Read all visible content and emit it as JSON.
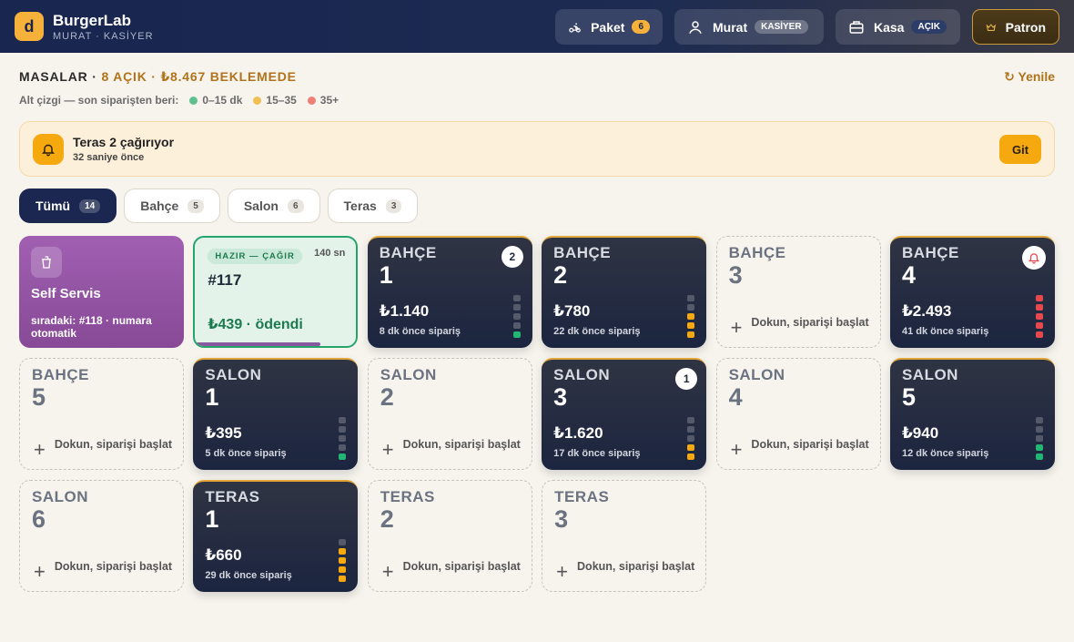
{
  "app": {
    "logo_letter": "d",
    "name": "BurgerLab",
    "user_line": "MURAT · KASİYER"
  },
  "header": {
    "package": {
      "label": "Paket",
      "count": "6",
      "icon": "scooter-icon"
    },
    "user": {
      "label": "Murat",
      "role": "KASİYER",
      "icon": "user-icon"
    },
    "register": {
      "label": "Kasa",
      "status": "AÇIK",
      "icon": "register-icon"
    },
    "boss": {
      "label": "Patron",
      "icon": "crown-icon"
    }
  },
  "summary": {
    "prefix": "MASALAR · ",
    "open": "8 AÇIK · ₺8.467 BEKLEMEDE",
    "refresh": "↻ Yenile"
  },
  "legend": {
    "label": "Alt çizgi — son siparişten beri:",
    "items": [
      {
        "text": "0–15 dk",
        "color": "#5fbf8f"
      },
      {
        "text": "15–35",
        "color": "#f2bf55"
      },
      {
        "text": "35+",
        "color": "#ee7f74"
      }
    ]
  },
  "alert": {
    "title": "Teras 2 çağırıyor",
    "subtitle": "32 saniye önce",
    "button": "Git"
  },
  "filters": [
    {
      "label": "Tümü",
      "count": "14"
    },
    {
      "label": "Bahçe",
      "count": "5"
    },
    {
      "label": "Salon",
      "count": "6"
    },
    {
      "label": "Teras",
      "count": "3"
    }
  ],
  "self_service": {
    "title": "Self Servis",
    "next": "sıradaki: #118 · numara otomatik"
  },
  "ready_order": {
    "tag": "HAZIR — ÇAĞIR",
    "seconds": "140 sn",
    "number": "#117",
    "paid": "₺439 · ödendi",
    "progress": 0.78
  },
  "start_text": "Dokun, siparişi başlat",
  "tables": [
    {
      "zone": "BAHÇE",
      "num": "1",
      "busy": true,
      "amount": "₺1.140",
      "ago": "8 dk önce sipariş",
      "badge": "2",
      "level": 1,
      "color": "#22b573"
    },
    {
      "zone": "BAHÇE",
      "num": "2",
      "busy": true,
      "amount": "₺780",
      "ago": "22 dk önce sipariş",
      "level": 3,
      "color": "#f5a90f"
    },
    {
      "zone": "BAHÇE",
      "num": "3",
      "busy": false
    },
    {
      "zone": "BAHÇE",
      "num": "4",
      "busy": true,
      "amount": "₺2.493",
      "ago": "41 dk önce sipariş",
      "bell": true,
      "level": 5,
      "color": "#e5484d"
    },
    {
      "zone": "BAHÇE",
      "num": "5",
      "busy": false
    },
    {
      "zone": "SALON",
      "num": "1",
      "busy": true,
      "amount": "₺395",
      "ago": "5 dk önce sipariş",
      "level": 1,
      "color": "#22b573"
    },
    {
      "zone": "SALON",
      "num": "2",
      "busy": false
    },
    {
      "zone": "SALON",
      "num": "3",
      "busy": true,
      "amount": "₺1.620",
      "ago": "17 dk önce sipariş",
      "badge": "1",
      "level": 2,
      "color": "#f5a90f"
    },
    {
      "zone": "SALON",
      "num": "4",
      "busy": false
    },
    {
      "zone": "SALON",
      "num": "5",
      "busy": true,
      "amount": "₺940",
      "ago": "12 dk önce sipariş",
      "level": 2,
      "color": "#22b573"
    },
    {
      "zone": "SALON",
      "num": "6",
      "busy": false
    },
    {
      "zone": "TERAS",
      "num": "1",
      "busy": true,
      "amount": "₺660",
      "ago": "29 dk önce sipariş",
      "level": 4,
      "color": "#f5a90f"
    },
    {
      "zone": "TERAS",
      "num": "2",
      "busy": false
    },
    {
      "zone": "TERAS",
      "num": "3",
      "busy": false
    }
  ]
}
